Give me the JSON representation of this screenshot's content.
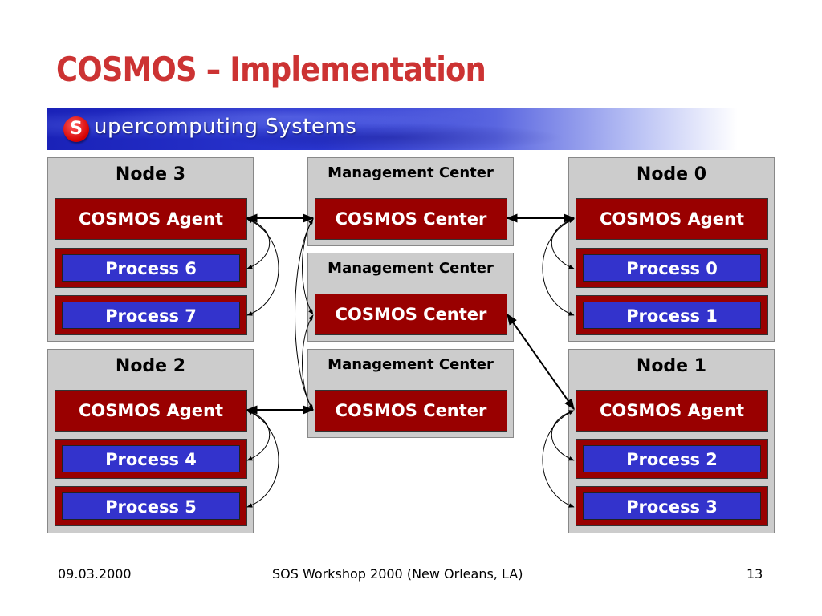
{
  "title": "COSMOS – Implementation",
  "banner": {
    "logo_letter": "S",
    "text": "upercomputing Systems"
  },
  "nodes": [
    {
      "id": "node3",
      "title": "Node 3",
      "agent": "COSMOS Agent",
      "processes": [
        "Process 6",
        "Process 7"
      ]
    },
    {
      "id": "node2",
      "title": "Node 2",
      "agent": "COSMOS Agent",
      "processes": [
        "Process 4",
        "Process 5"
      ]
    },
    {
      "id": "node0",
      "title": "Node 0",
      "agent": "COSMOS Agent",
      "processes": [
        "Process 0",
        "Process 1"
      ]
    },
    {
      "id": "node1",
      "title": "Node 1",
      "agent": "COSMOS Agent",
      "processes": [
        "Process 2",
        "Process 3"
      ]
    }
  ],
  "management_centers": [
    {
      "title": "Management Center",
      "center": "COSMOS Center"
    },
    {
      "title": "Management Center",
      "center": "COSMOS Center"
    },
    {
      "title": "Management Center",
      "center": "COSMOS Center"
    }
  ],
  "connections": [
    {
      "from": "Node 3 COSMOS Agent",
      "to": "Management Center 1 COSMOS Center",
      "type": "bidirectional"
    },
    {
      "from": "Management Center 1 COSMOS Center",
      "to": "Node 0 COSMOS Agent",
      "type": "bidirectional"
    },
    {
      "from": "Node 2 COSMOS Agent",
      "to": "Management Center 3 COSMOS Center",
      "type": "bidirectional"
    },
    {
      "from": "Management Center 2 COSMOS Center",
      "to": "Node 1 COSMOS Agent",
      "type": "bidirectional"
    }
  ],
  "colors": {
    "title": "#cc3333",
    "agent_fill": "#990000",
    "process_fill": "#3333cc",
    "box_fill": "#cccccc"
  },
  "footer": {
    "date": "09.03.2000",
    "event": "SOS Workshop 2000 (New Orleans, LA)",
    "page": "13"
  }
}
